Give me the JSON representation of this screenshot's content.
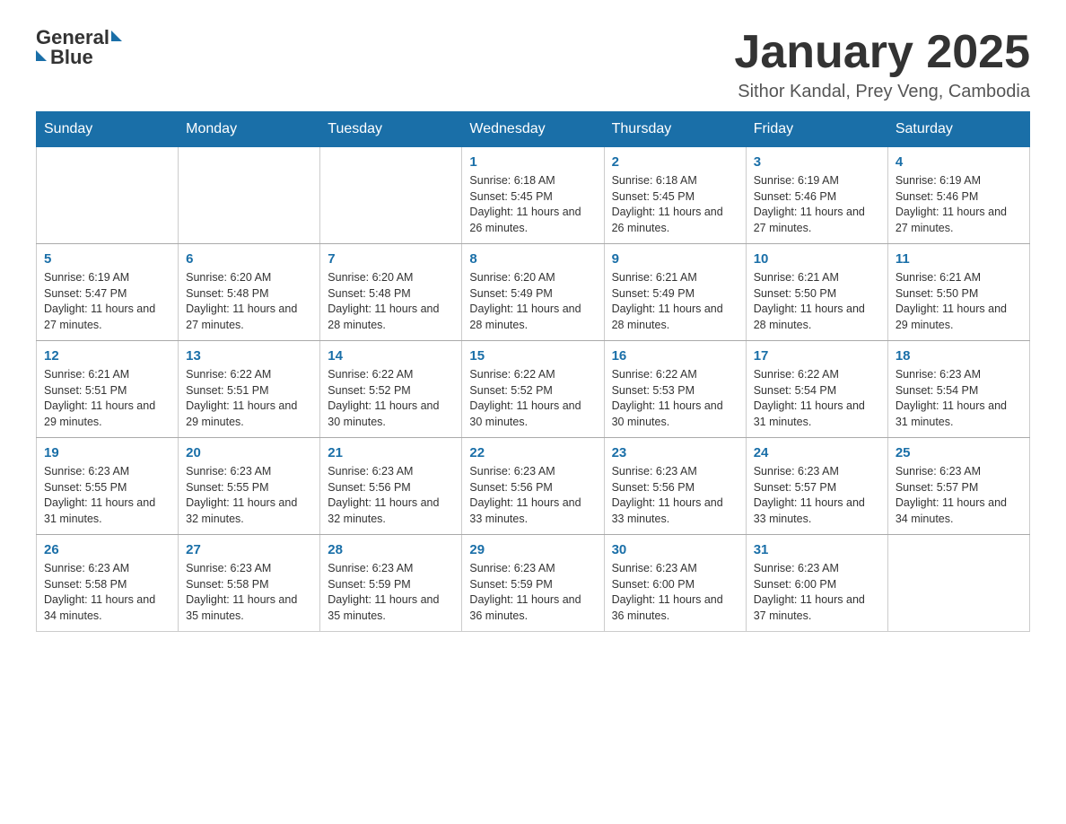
{
  "logo": {
    "text_general": "General",
    "text_blue": "Blue"
  },
  "header": {
    "title": "January 2025",
    "location": "Sithor Kandal, Prey Veng, Cambodia"
  },
  "days_of_week": [
    "Sunday",
    "Monday",
    "Tuesday",
    "Wednesday",
    "Thursday",
    "Friday",
    "Saturday"
  ],
  "weeks": [
    [
      {
        "day": "",
        "info": ""
      },
      {
        "day": "",
        "info": ""
      },
      {
        "day": "",
        "info": ""
      },
      {
        "day": "1",
        "info": "Sunrise: 6:18 AM\nSunset: 5:45 PM\nDaylight: 11 hours and 26 minutes."
      },
      {
        "day": "2",
        "info": "Sunrise: 6:18 AM\nSunset: 5:45 PM\nDaylight: 11 hours and 26 minutes."
      },
      {
        "day": "3",
        "info": "Sunrise: 6:19 AM\nSunset: 5:46 PM\nDaylight: 11 hours and 27 minutes."
      },
      {
        "day": "4",
        "info": "Sunrise: 6:19 AM\nSunset: 5:46 PM\nDaylight: 11 hours and 27 minutes."
      }
    ],
    [
      {
        "day": "5",
        "info": "Sunrise: 6:19 AM\nSunset: 5:47 PM\nDaylight: 11 hours and 27 minutes."
      },
      {
        "day": "6",
        "info": "Sunrise: 6:20 AM\nSunset: 5:48 PM\nDaylight: 11 hours and 27 minutes."
      },
      {
        "day": "7",
        "info": "Sunrise: 6:20 AM\nSunset: 5:48 PM\nDaylight: 11 hours and 28 minutes."
      },
      {
        "day": "8",
        "info": "Sunrise: 6:20 AM\nSunset: 5:49 PM\nDaylight: 11 hours and 28 minutes."
      },
      {
        "day": "9",
        "info": "Sunrise: 6:21 AM\nSunset: 5:49 PM\nDaylight: 11 hours and 28 minutes."
      },
      {
        "day": "10",
        "info": "Sunrise: 6:21 AM\nSunset: 5:50 PM\nDaylight: 11 hours and 28 minutes."
      },
      {
        "day": "11",
        "info": "Sunrise: 6:21 AM\nSunset: 5:50 PM\nDaylight: 11 hours and 29 minutes."
      }
    ],
    [
      {
        "day": "12",
        "info": "Sunrise: 6:21 AM\nSunset: 5:51 PM\nDaylight: 11 hours and 29 minutes."
      },
      {
        "day": "13",
        "info": "Sunrise: 6:22 AM\nSunset: 5:51 PM\nDaylight: 11 hours and 29 minutes."
      },
      {
        "day": "14",
        "info": "Sunrise: 6:22 AM\nSunset: 5:52 PM\nDaylight: 11 hours and 30 minutes."
      },
      {
        "day": "15",
        "info": "Sunrise: 6:22 AM\nSunset: 5:52 PM\nDaylight: 11 hours and 30 minutes."
      },
      {
        "day": "16",
        "info": "Sunrise: 6:22 AM\nSunset: 5:53 PM\nDaylight: 11 hours and 30 minutes."
      },
      {
        "day": "17",
        "info": "Sunrise: 6:22 AM\nSunset: 5:54 PM\nDaylight: 11 hours and 31 minutes."
      },
      {
        "day": "18",
        "info": "Sunrise: 6:23 AM\nSunset: 5:54 PM\nDaylight: 11 hours and 31 minutes."
      }
    ],
    [
      {
        "day": "19",
        "info": "Sunrise: 6:23 AM\nSunset: 5:55 PM\nDaylight: 11 hours and 31 minutes."
      },
      {
        "day": "20",
        "info": "Sunrise: 6:23 AM\nSunset: 5:55 PM\nDaylight: 11 hours and 32 minutes."
      },
      {
        "day": "21",
        "info": "Sunrise: 6:23 AM\nSunset: 5:56 PM\nDaylight: 11 hours and 32 minutes."
      },
      {
        "day": "22",
        "info": "Sunrise: 6:23 AM\nSunset: 5:56 PM\nDaylight: 11 hours and 33 minutes."
      },
      {
        "day": "23",
        "info": "Sunrise: 6:23 AM\nSunset: 5:56 PM\nDaylight: 11 hours and 33 minutes."
      },
      {
        "day": "24",
        "info": "Sunrise: 6:23 AM\nSunset: 5:57 PM\nDaylight: 11 hours and 33 minutes."
      },
      {
        "day": "25",
        "info": "Sunrise: 6:23 AM\nSunset: 5:57 PM\nDaylight: 11 hours and 34 minutes."
      }
    ],
    [
      {
        "day": "26",
        "info": "Sunrise: 6:23 AM\nSunset: 5:58 PM\nDaylight: 11 hours and 34 minutes."
      },
      {
        "day": "27",
        "info": "Sunrise: 6:23 AM\nSunset: 5:58 PM\nDaylight: 11 hours and 35 minutes."
      },
      {
        "day": "28",
        "info": "Sunrise: 6:23 AM\nSunset: 5:59 PM\nDaylight: 11 hours and 35 minutes."
      },
      {
        "day": "29",
        "info": "Sunrise: 6:23 AM\nSunset: 5:59 PM\nDaylight: 11 hours and 36 minutes."
      },
      {
        "day": "30",
        "info": "Sunrise: 6:23 AM\nSunset: 6:00 PM\nDaylight: 11 hours and 36 minutes."
      },
      {
        "day": "31",
        "info": "Sunrise: 6:23 AM\nSunset: 6:00 PM\nDaylight: 11 hours and 37 minutes."
      },
      {
        "day": "",
        "info": ""
      }
    ]
  ]
}
